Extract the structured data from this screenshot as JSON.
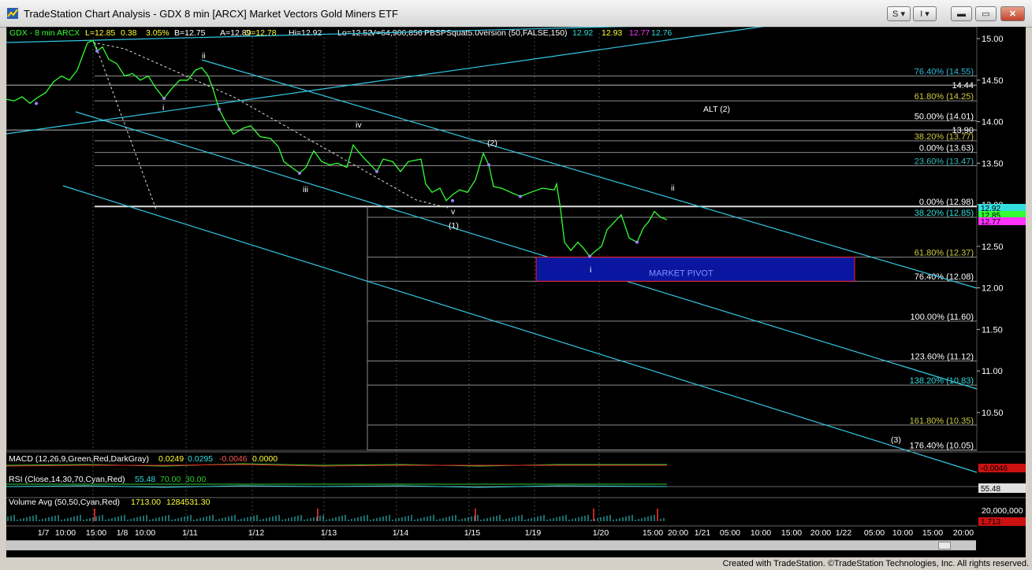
{
  "window": {
    "title": "TradeStation Chart Analysis - GDX 8 min [ARCX] Market Vectors Gold Miners ETF",
    "btn_s": "S",
    "btn_l": "I",
    "dropdown_glyph": "▾",
    "min_glyph": "▬",
    "max_glyph": "▭",
    "close_glyph": "✕"
  },
  "footer": "Created with TradeStation. ©TradeStation Technologies, Inc. All rights reserved.",
  "colors": {
    "background": "#000000",
    "price_line": "#33ff33",
    "channel": "#33c8e6",
    "fib_line": "#b8b8b8",
    "pivot_fill": "#0a16a0",
    "pivot_border": "#ff2020",
    "macd": "#33cc33",
    "macd_signal": "#ee2222",
    "rsi": "#33dddd",
    "volume": "#33dddd"
  },
  "header": {
    "symbol": "GDX - 8 min",
    "exchange": "ARCX",
    "last": "L=12.85",
    "change": "0.38",
    "pct": "3.05%",
    "bid": "B=12.75",
    "ask": "A=12.89",
    "open": "O=12.78",
    "high": "Hi=12.92",
    "low": "Lo=12.52",
    "volume": "V=64,906,856",
    "study": "PBSPSquat5.0version (50,FALSE,150)",
    "v1": "12.92",
    "v2": "12.93",
    "v3": "12.77",
    "v4": "12.76"
  },
  "price_axis": [
    "15.00",
    "14.50",
    "14.00",
    "13.50",
    "13.00",
    "12.50",
    "12.00",
    "11.50",
    "11.00",
    "10.50"
  ],
  "price_badges": [
    {
      "text": "12.92",
      "bg": "#33dddd",
      "fg": "#000000"
    },
    {
      "text": "12.85",
      "bg": "#33ff33",
      "fg": "#000000"
    },
    {
      "text": "12.77",
      "bg": "#ff33ff",
      "fg": "#000000"
    }
  ],
  "fib_left": [
    {
      "label": "76.40% (14.55)",
      "price": 14.55
    },
    {
      "label": "61.80% (14.25)",
      "price": 14.25
    },
    {
      "label": "50.00% (14.01)",
      "price": 14.01
    },
    {
      "label": "38.20% (13.77)",
      "price": 13.77
    },
    {
      "label": "23.60% (13.47)",
      "price": 13.47
    }
  ],
  "fib_right": [
    {
      "label": "0.00% (13.63)",
      "price": 13.63
    },
    {
      "label": "0.00% (12.98)",
      "price": 12.98
    },
    {
      "label": "38.20% (12.85)",
      "price": 12.85
    },
    {
      "label": "61.80% (12.37)",
      "price": 12.37
    },
    {
      "label": "76.40% (12.08)",
      "price": 12.08
    },
    {
      "label": "100.00% (11.60)",
      "price": 11.6
    },
    {
      "label": "123.60% (11.12)",
      "price": 11.12
    },
    {
      "label": "138.20% (10.83)",
      "price": 10.83
    },
    {
      "label": "161.80% (10.35)",
      "price": 10.35
    },
    {
      "label": "176.40% (10.05)",
      "price": 10.05
    }
  ],
  "level_labels": [
    {
      "label": "14.44",
      "price": 14.44
    },
    {
      "label": "13.90",
      "price": 13.9
    }
  ],
  "wave_labels": [
    "ii",
    "i",
    "iii",
    "iv",
    "v",
    "(1)",
    "(2)",
    "ii",
    "i",
    "ALT (2)",
    "(3)"
  ],
  "pivot_label": "MARKET PIVOT",
  "time_axis": [
    "1/7",
    "10:00",
    "15:00",
    "1/8",
    "10:00",
    "1/11",
    "1/12",
    "1/13",
    "1/14",
    "1/15",
    "1/19",
    "1/20",
    "15:00",
    "20:00",
    "1/21",
    "05:00",
    "10:00",
    "15:00",
    "20:00",
    "1/22",
    "05:00",
    "10:00",
    "15:00",
    "20:00"
  ],
  "macd": {
    "label": "MACD (12,26,9,Green,Red,DarkGray)",
    "v1": "0.0249",
    "v2": "0.0295",
    "v3": "-0.0046",
    "v4": "0.0000",
    "badge": "-0.0046"
  },
  "rsi": {
    "label": "RSI (Close,14,30,70,Cyan,Red)",
    "v1": "55.48",
    "v2": "70.00",
    "v3": "30.00",
    "badge": "55.48"
  },
  "volume": {
    "label": "Volume Avg (50,50,Cyan,Red)",
    "v1": "1713.00",
    "v2": "1284531.30",
    "axis": "20,000,000",
    "badge": "1,713"
  }
}
